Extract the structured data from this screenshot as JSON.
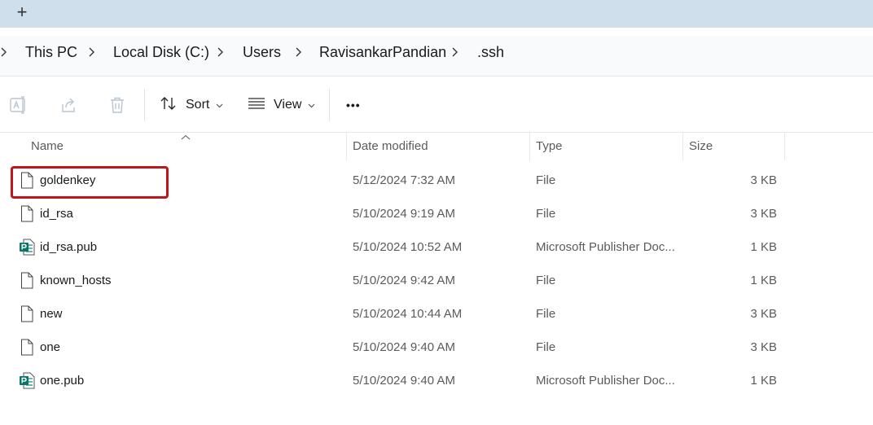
{
  "window": {
    "new_tab_label": "+"
  },
  "breadcrumb": {
    "items": [
      {
        "label": "This PC"
      },
      {
        "label": "Local Disk (C:)"
      },
      {
        "label": "Users"
      },
      {
        "label": "RavisankarPandian"
      },
      {
        "label": ".ssh"
      }
    ]
  },
  "toolbar": {
    "sort_label": "Sort",
    "view_label": "View",
    "more_label": "•••"
  },
  "columns": {
    "name": "Name",
    "date": "Date modified",
    "type": "Type",
    "size": "Size"
  },
  "files": [
    {
      "name": "goldenkey",
      "date": "5/12/2024 7:32 AM",
      "type": "File",
      "size": "3 KB",
      "icon": "generic-file-icon"
    },
    {
      "name": "id_rsa",
      "date": "5/10/2024 9:19 AM",
      "type": "File",
      "size": "3 KB",
      "icon": "generic-file-icon"
    },
    {
      "name": "id_rsa.pub",
      "date": "5/10/2024 10:52 AM",
      "type": "Microsoft Publisher Doc...",
      "size": "1 KB",
      "icon": "publisher-file-icon"
    },
    {
      "name": "known_hosts",
      "date": "5/10/2024 9:42 AM",
      "type": "File",
      "size": "1 KB",
      "icon": "generic-file-icon"
    },
    {
      "name": "new",
      "date": "5/10/2024 10:44 AM",
      "type": "File",
      "size": "3 KB",
      "icon": "generic-file-icon"
    },
    {
      "name": "one",
      "date": "5/10/2024 9:40 AM",
      "type": "File",
      "size": "3 KB",
      "icon": "generic-file-icon"
    },
    {
      "name": "one.pub",
      "date": "5/10/2024 9:40 AM",
      "type": "Microsoft Publisher Doc...",
      "size": "1 KB",
      "icon": "publisher-file-icon"
    }
  ],
  "colors": {
    "tab_strip": "#cfdfec",
    "highlight_border": "#c0161b",
    "publisher_green": "#077568"
  }
}
